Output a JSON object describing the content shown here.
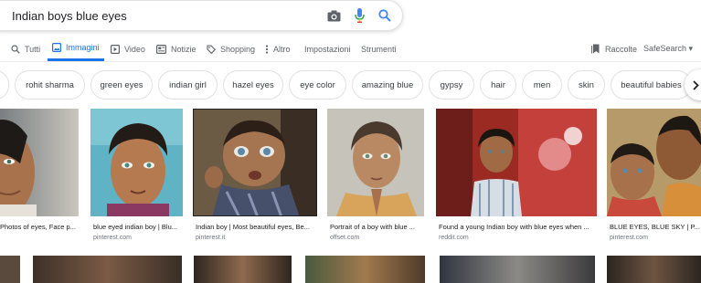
{
  "search": {
    "query": "Indian boys blue eyes",
    "camera_icon": "camera-icon",
    "mic_icon": "mic-icon",
    "search_icon": "search-icon"
  },
  "tabs": [
    {
      "label": "Tutti",
      "icon": "search-icon"
    },
    {
      "label": "Immagini",
      "icon": "image-icon",
      "active": true
    },
    {
      "label": "Video",
      "icon": "play-icon"
    },
    {
      "label": "Notizie",
      "icon": "news-icon"
    },
    {
      "label": "Shopping",
      "icon": "tag-icon"
    },
    {
      "label": "Altro",
      "icon": "more-vert-icon"
    },
    {
      "label": "Impostazioni"
    },
    {
      "label": "Strumenti"
    }
  ],
  "right_tools": {
    "collections_label": "Raccolte",
    "safesearch_label": "SafeSearch ▾"
  },
  "chips": [
    "rohit sharma",
    "green eyes",
    "indian girl",
    "hazel eyes",
    "eye color",
    "amazing blue",
    "gypsy",
    "hair",
    "men",
    "skin",
    "beautiful babies"
  ],
  "results": [
    {
      "caption": "Photos of eyes, Face p...",
      "domain": ""
    },
    {
      "caption": "blue eyed indian boy | Blu...",
      "domain": "pinterest.com"
    },
    {
      "caption": "Indian boy | Most beautiful eyes, Be...",
      "domain": "pinterest.it"
    },
    {
      "caption": "Portrait of a boy with blue ...",
      "domain": "offset.com"
    },
    {
      "caption": "Found a young Indian boy with blue eyes when ...",
      "domain": "reddit.com"
    },
    {
      "caption": "BLUE EYES, BLUE SKY | P...",
      "domain": "pinterest.com"
    }
  ],
  "colors": {
    "accent": "#1a73e8",
    "mic_blue": "#4285f4",
    "mic_red": "#ea4335",
    "text_secondary": "#5f6368",
    "domain_gray": "#70757a"
  }
}
